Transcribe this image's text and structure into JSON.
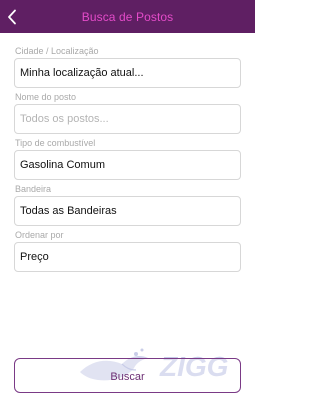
{
  "header": {
    "title": "Busca de Postos",
    "back_icon": "chevron-left-icon",
    "background_color": "#5f1f63",
    "title_color": "#e44bc9"
  },
  "form": {
    "location": {
      "label": "Cidade / Localização",
      "value": "Minha localização atual..."
    },
    "station_name": {
      "label": "Nome do posto",
      "placeholder": "Todos os postos..."
    },
    "fuel_type": {
      "label": "Tipo de combustível",
      "value": "Gasolina Comum"
    },
    "brand": {
      "label": "Bandeira",
      "value": "Todas as Bandeiras"
    },
    "sort_by": {
      "label": "Ordenar por",
      "value": "Preço"
    }
  },
  "search_button": {
    "label": "Buscar",
    "border_color": "#7a3a86"
  },
  "watermark": {
    "text": "ZIGG"
  }
}
